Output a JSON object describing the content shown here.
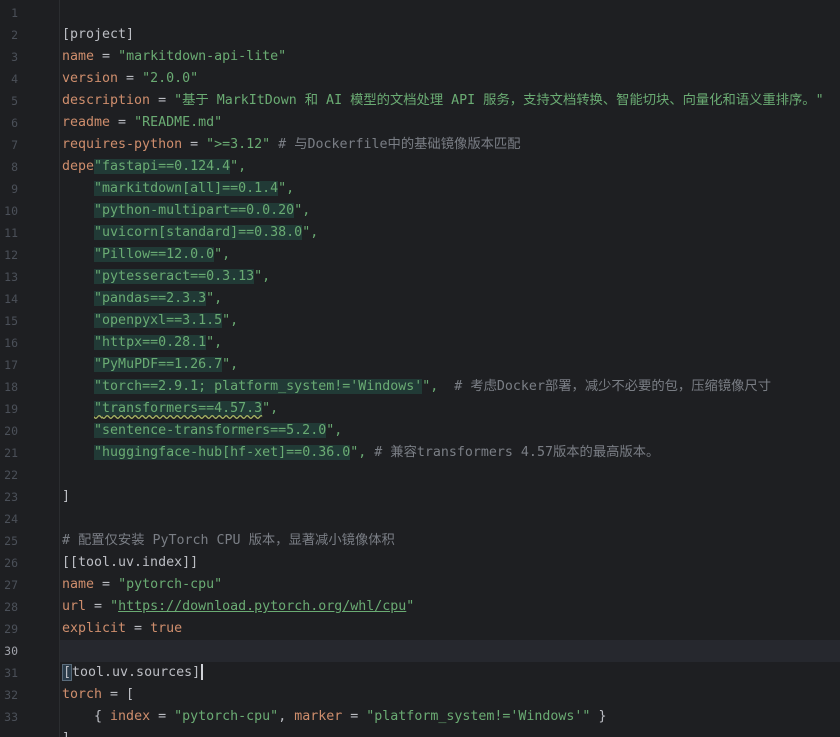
{
  "editor": {
    "current_line": "30",
    "line_numbers": [
      "1",
      "2",
      "3",
      "4",
      "5",
      "6",
      "7",
      "8",
      "9",
      "10",
      "11",
      "12",
      "13",
      "14",
      "15",
      "16",
      "17",
      "18",
      "19",
      "20",
      "21",
      "22",
      "23",
      "24",
      "25",
      "26",
      "27",
      "28",
      "29",
      "30",
      "31",
      "32",
      "33"
    ],
    "lines": {
      "l1": "[project]",
      "l2_key": "name",
      "l2_eq": " = ",
      "l2_val": "\"markitdown-api-lite\"",
      "l3_key": "version",
      "l3_eq": " = ",
      "l3_val": "\"2.0.0\"",
      "l4_key": "description",
      "l4_eq": " = ",
      "l4_val": "\"基于 MarkItDown 和 AI 模型的文档处理 API 服务，支持文档转换、智能切块、向量化和语义重排序。\"",
      "l5_key": "readme",
      "l5_eq": " = ",
      "l5_val": "\"README.md\"",
      "l6_key": "requires-python",
      "l6_eq": " = ",
      "l6_val": "\">=3.12\"",
      "l6_comment": " # 与Dockerfile中的基础镜像版本匹配",
      "l7_key": "dependencies",
      "l7_eq": " = [",
      "deps": [
        {
          "name": "fastapi==",
          "ver": "0.124.4",
          "tail": "\","
        },
        {
          "name": "markitdown[all]==",
          "ver": "0.1.4",
          "tail": "\","
        },
        {
          "name": "python-multipart==",
          "ver": "0.0.20",
          "tail": "\","
        },
        {
          "name": "uvicorn[standard]==",
          "ver": "0.38.0",
          "tail": "\","
        },
        {
          "name": "Pillow==",
          "ver": "12.0.0",
          "tail": "\","
        },
        {
          "name": "pytesseract==",
          "ver": "0.3.13",
          "tail": "\","
        },
        {
          "name": "pandas==",
          "ver": "2.3.3",
          "tail": "\","
        },
        {
          "name": "openpyxl==",
          "ver": "3.1.5",
          "tail": "\","
        },
        {
          "name": "httpx==",
          "ver": "0.28.1",
          "tail": "\","
        },
        {
          "name": "PyMuPDF==",
          "ver": "1.26.7",
          "tail": "\","
        },
        {
          "name": "torch==",
          "ver": "2.9.1; platform_system!='Windows'",
          "tail": "\",",
          "comment": "  # 考虑Docker部署，减少不必要的包，压缩镜像尺寸"
        },
        {
          "name": "transformers==",
          "ver": "4.57.3",
          "tail": "\","
        },
        {
          "name": "sentence-transformers==",
          "ver": "5.2.0",
          "tail": "\","
        },
        {
          "name": "huggingface-hub[hf-xet]==",
          "ver": "0.36.0",
          "tail": "\",",
          "comment": " # 兼容transformers 4.57版本的最高版本。"
        }
      ],
      "l22": "]",
      "l24": "# 配置仅安装 PyTorch CPU 版本，显著减小镜像体积",
      "l25": "[[tool.uv.index]]",
      "l26_key": "name",
      "l26_eq": " = ",
      "l26_val": "\"pytorch-cpu\"",
      "l27_key": "url",
      "l27_eq": " = ",
      "l27_q1": "\"",
      "l27_url": "https://download.pytorch.org/whl/cpu",
      "l27_q2": "\"",
      "l28_key": "explicit",
      "l28_eq": " = ",
      "l28_val": "true",
      "l30": "[tool.uv.sources]",
      "l31_key": "torch",
      "l31_eq": " = [",
      "l32_open": "    { ",
      "l32_k1": "index",
      "l32_eq1": " = ",
      "l32_v1": "\"pytorch-cpu\"",
      "l32_comma": ", ",
      "l32_k2": "marker",
      "l32_eq2": " = ",
      "l32_v2": "\"platform_system!='Windows'\"",
      "l32_close": " }",
      "l33": "]"
    }
  },
  "colors": {
    "background": "#1e1f22",
    "key": "#cf8e6d",
    "string": "#6aab73",
    "comment": "#7a7e85",
    "text": "#bcbec4",
    "line_number": "#4b5059"
  }
}
